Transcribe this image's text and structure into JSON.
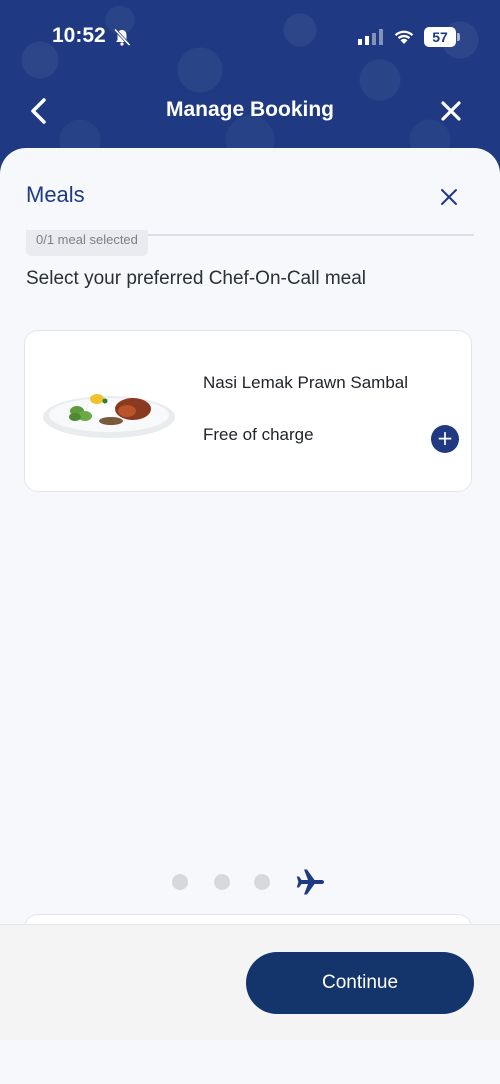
{
  "status_bar": {
    "time": "10:52",
    "battery": "57",
    "icons": [
      "bell-muted-icon",
      "signal-icon",
      "wifi-icon",
      "battery-icon"
    ]
  },
  "nav": {
    "title": "Manage Booking",
    "back_icon": "chevron-left-icon",
    "close_icon": "close-icon"
  },
  "meals": {
    "title": "Meals",
    "counter": "0/1 meal selected",
    "instruction": "Select your preferred Chef-On-Call meal",
    "items": [
      {
        "name": "Nasi Lemak Prawn Sambal",
        "price": "Free of charge",
        "add_label": "+"
      }
    ]
  },
  "progress": {
    "steps": 4,
    "current_icon": "airplane-icon"
  },
  "footer": {
    "continue_label": "Continue"
  },
  "colors": {
    "brand_blue": "#1f3a82",
    "button_navy": "#13356b",
    "sheet_bg": "#f7f8fb"
  }
}
